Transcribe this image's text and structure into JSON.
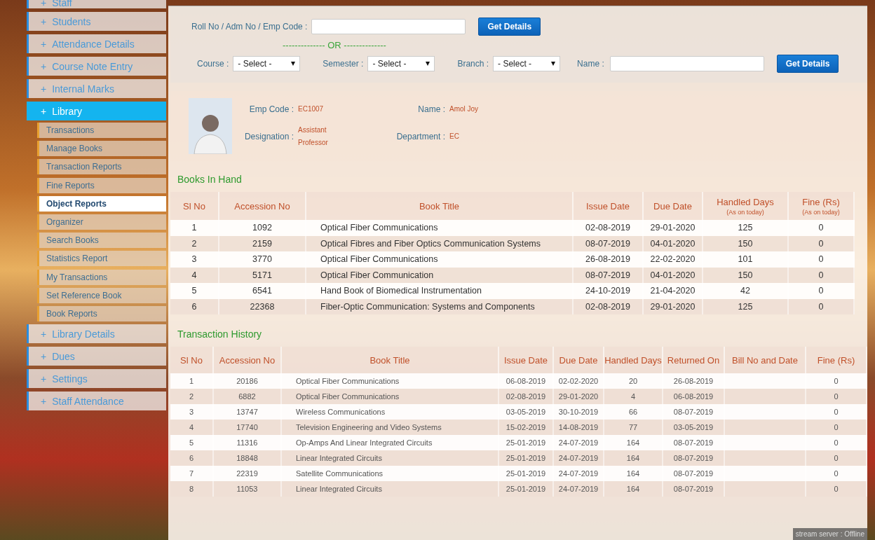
{
  "sidebar": {
    "items": [
      {
        "toggle": "+",
        "label": "Staff",
        "selected": false
      },
      {
        "toggle": "+",
        "label": "Students",
        "selected": false
      },
      {
        "toggle": "+",
        "label": "Attendance Details",
        "selected": false
      },
      {
        "toggle": "+",
        "label": "Course Note Entry",
        "selected": false
      },
      {
        "toggle": "+",
        "label": "Internal Marks",
        "selected": false
      },
      {
        "toggle": "+",
        "label": "Library",
        "selected": true,
        "children": [
          {
            "label": "Transactions",
            "selected": false
          },
          {
            "label": "Manage Books",
            "selected": false
          },
          {
            "label": "Transaction Reports",
            "selected": false
          },
          {
            "label": "Fine Reports",
            "selected": false
          },
          {
            "label": "Object Reports",
            "selected": true
          },
          {
            "label": "Organizer",
            "selected": false
          },
          {
            "label": "Search Books",
            "selected": false
          },
          {
            "label": "Statistics Report",
            "selected": false
          },
          {
            "label": "My Transactions",
            "selected": false
          },
          {
            "label": "Set Reference Book",
            "selected": false
          },
          {
            "label": "Book Reports",
            "selected": false
          }
        ]
      },
      {
        "toggle": "+",
        "label": "Library Details",
        "selected": false
      },
      {
        "toggle": "+",
        "label": "Dues",
        "selected": false
      },
      {
        "toggle": "+",
        "label": "Settings",
        "selected": false
      },
      {
        "toggle": "+",
        "label": "Staff Attendance",
        "selected": false
      }
    ]
  },
  "search": {
    "code_label": "Roll No / Adm No / Emp Code :",
    "code_button": "Get Details",
    "separator": "-------------- OR --------------",
    "filters": [
      {
        "label": "Course :",
        "value": "- Select -"
      },
      {
        "label": "Semester :",
        "value": "- Select -"
      },
      {
        "label": "Branch :",
        "value": "- Select -"
      }
    ],
    "name_label": "Name :",
    "name_button": "Get Details"
  },
  "profile": {
    "fields": [
      {
        "label": "Emp Code :",
        "value": "EC1007"
      },
      {
        "label": "Name :",
        "value": "Amol Joy"
      },
      {
        "label": "Designation :",
        "value": "Assistant Professor"
      },
      {
        "label": "Department :",
        "value": "EC"
      }
    ]
  },
  "books_in_hand": {
    "title": "Books In Hand",
    "columns": [
      {
        "label": "Sl No"
      },
      {
        "label": "Accession No"
      },
      {
        "label": "Book Title"
      },
      {
        "label": "Issue Date"
      },
      {
        "label": "Due Date"
      },
      {
        "label": "Handled Days",
        "note": "(As on today)"
      },
      {
        "label": "Fine (Rs)",
        "note": "(As on today)"
      }
    ],
    "rows": [
      [
        "1",
        "1092",
        "Optical Fiber Communications",
        "02-08-2019",
        "29-01-2020",
        "125",
        "0"
      ],
      [
        "2",
        "2159",
        "Optical Fibres and Fiber Optics Communication Systems",
        "08-07-2019",
        "04-01-2020",
        "150",
        "0"
      ],
      [
        "3",
        "3770",
        "Optical Fiber Communications",
        "26-08-2019",
        "22-02-2020",
        "101",
        "0"
      ],
      [
        "4",
        "5171",
        "Optical Fiber Communication",
        "08-07-2019",
        "04-01-2020",
        "150",
        "0"
      ],
      [
        "5",
        "6541",
        "Hand Book of Biomedical Instrumentation",
        "24-10-2019",
        "21-04-2020",
        "42",
        "0"
      ],
      [
        "6",
        "22368",
        "Fiber-Optic Communication: Systems and Components",
        "02-08-2019",
        "29-01-2020",
        "125",
        "0"
      ]
    ]
  },
  "transaction_history": {
    "title": "Transaction History",
    "columns": [
      {
        "label": "Sl No"
      },
      {
        "label": "Accession No"
      },
      {
        "label": "Book Title"
      },
      {
        "label": "Issue Date"
      },
      {
        "label": "Due Date"
      },
      {
        "label": "Handled Days"
      },
      {
        "label": "Returned On"
      },
      {
        "label": "Bill No and Date"
      },
      {
        "label": "Fine (Rs)"
      }
    ],
    "rows": [
      [
        "1",
        "20186",
        "Optical Fiber Communications",
        "06-08-2019",
        "02-02-2020",
        "20",
        "26-08-2019",
        null,
        "0"
      ],
      [
        "2",
        "6882",
        "Optical Fiber Communications",
        "02-08-2019",
        "29-01-2020",
        "4",
        "06-08-2019",
        null,
        "0"
      ],
      [
        "3",
        "13747",
        "Wireless Communications",
        "03-05-2019",
        "30-10-2019",
        "66",
        "08-07-2019",
        null,
        "0"
      ],
      [
        "4",
        "17740",
        "Television Engineering and Video Systems",
        "15-02-2019",
        "14-08-2019",
        "77",
        "03-05-2019",
        null,
        "0"
      ],
      [
        "5",
        "11316",
        "Op-Amps And Linear Integrated Circuits",
        "25-01-2019",
        "24-07-2019",
        "164",
        "08-07-2019",
        null,
        "0"
      ],
      [
        "6",
        "18848",
        "Linear Integrated Circuits",
        "25-01-2019",
        "24-07-2019",
        "164",
        "08-07-2019",
        null,
        "0"
      ],
      [
        "7",
        "22319",
        "Satellite Communications",
        "25-01-2019",
        "24-07-2019",
        "164",
        "08-07-2019",
        null,
        "0"
      ],
      [
        "8",
        "11053",
        "Linear Integrated Circuits",
        "25-01-2019",
        "24-07-2019",
        "164",
        "08-07-2019",
        null,
        "0"
      ]
    ]
  },
  "status_tooltip": "stream server : Offline"
}
